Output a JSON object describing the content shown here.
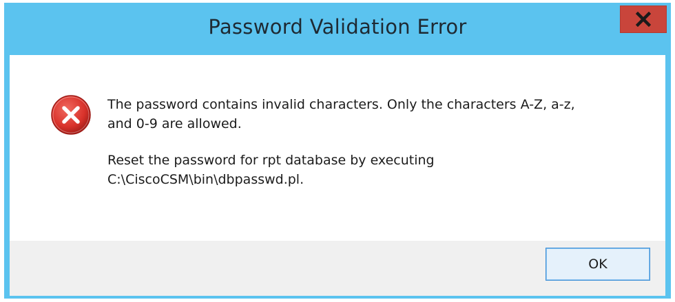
{
  "dialog": {
    "title": "Password Validation Error",
    "close_icon": "close-icon",
    "icon": "error-icon",
    "message_line1": "The password contains invalid characters. Only the characters A-Z, a-z,",
    "message_line2": "and 0-9 are allowed.",
    "message2_line1": "Reset the password for rpt database by executing",
    "message2_line2": "C:\\CiscoCSM\\bin\\dbpasswd.pl.",
    "ok_label": "OK"
  },
  "colors": {
    "titlebar": "#5bc3ef",
    "close_button": "#c9453b",
    "error_icon": "#d9322b",
    "footer": "#f0f0f0",
    "ok_border": "#3c8ed6"
  }
}
